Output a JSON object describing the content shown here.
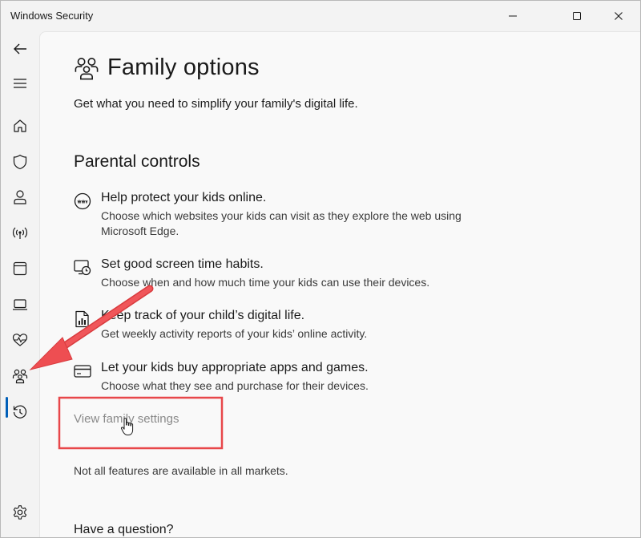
{
  "window": {
    "title": "Windows Security",
    "controls": [
      "minimize-icon",
      "maximize-icon",
      "close-icon"
    ]
  },
  "sidebar": {
    "items": [
      {
        "icon": "back-arrow-icon"
      },
      {
        "icon": "hamburger-menu-icon"
      },
      {
        "icon": "home-icon"
      },
      {
        "icon": "shield-icon"
      },
      {
        "icon": "person-icon"
      },
      {
        "icon": "wifi-antenna-icon"
      },
      {
        "icon": "app-browser-icon"
      },
      {
        "icon": "laptop-icon"
      },
      {
        "icon": "heart-pulse-icon"
      },
      {
        "icon": "family-icon",
        "active": true
      },
      {
        "icon": "history-icon"
      },
      {
        "icon": "gear-icon"
      }
    ]
  },
  "main": {
    "icon": "family-icon",
    "title": "Family options",
    "subtitle": "Get what you need to simplify your family's digital life.",
    "section_heading": "Parental controls",
    "features": [
      {
        "icon": "web-browser-icon",
        "title": "Help protect your kids online.",
        "description": "Choose which websites your kids can visit as they explore the web using Microsoft Edge."
      },
      {
        "icon": "screen-time-icon",
        "title": "Set good screen time habits.",
        "description": "Choose when and how much time your kids can use their devices."
      },
      {
        "icon": "activity-report-icon",
        "title": "Keep track of your child’s digital life.",
        "description": "Get weekly activity reports of your kids’ online activity."
      },
      {
        "icon": "credit-card-icon",
        "title": "Let your kids buy appropriate apps and games.",
        "description": "Choose what they see and purchase for their devices."
      }
    ],
    "link": "View family settings",
    "note": "Not all features are available in all markets.",
    "question_heading": "Have a question?"
  },
  "annotation": {
    "arrow_color": "#e8474a",
    "highlight_color": "#e8474a"
  },
  "colors": {
    "accent": "#005fb8",
    "link_disabled": "#8a8a8a"
  }
}
